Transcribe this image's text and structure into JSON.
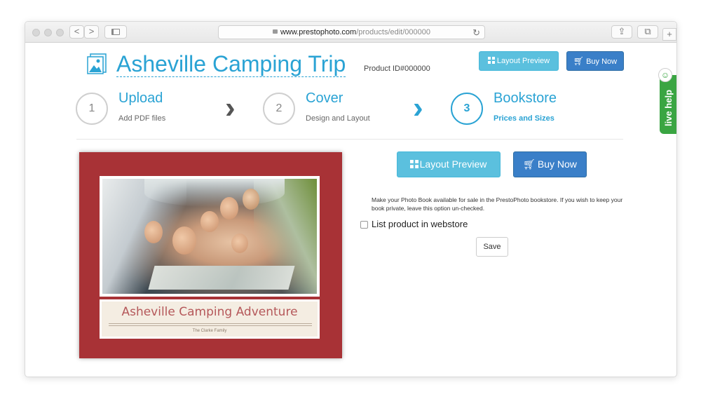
{
  "browser": {
    "url_host": "www.prestophoto.com",
    "url_path": "/products/edit/000000",
    "back_icon": "<",
    "forward_icon": ">",
    "reload_icon": "↻",
    "share_icon": "⇪",
    "tabs_icon": "⧉",
    "new_tab_icon": "+"
  },
  "header": {
    "title": "Asheville Camping Trip",
    "product_id": "Product ID#000000",
    "layout_preview_label": "Layout Preview",
    "buy_now_label": "Buy Now"
  },
  "steps": [
    {
      "number": "1",
      "title": "Upload",
      "subtitle": "Add PDF files"
    },
    {
      "number": "2",
      "title": "Cover",
      "subtitle": "Design and Layout"
    },
    {
      "number": "3",
      "title": "Bookstore",
      "subtitle": "Prices and Sizes",
      "active": true
    }
  ],
  "step_chevron": "›",
  "cover": {
    "title": "Asheville Camping Adventure",
    "subtitle": "The Clarke Family"
  },
  "bookstore": {
    "layout_preview_label": "Layout Preview",
    "buy_now_label": "Buy Now",
    "help_text": "Make your Photo Book available for sale in the PrestoPhoto bookstore. If you wish to keep your book private, leave this option un-checked.",
    "checkbox_label": "List product in webstore",
    "checkbox_checked": false,
    "save_label": "Save"
  },
  "live_help": {
    "label": "live help",
    "smiley": "☺"
  },
  "colors": {
    "accent": "#2aa3d4",
    "preview_button": "#5bc0de",
    "buy_button": "#3a7fc8",
    "cover_red": "#a83236",
    "live_help_green": "#3aa542"
  }
}
